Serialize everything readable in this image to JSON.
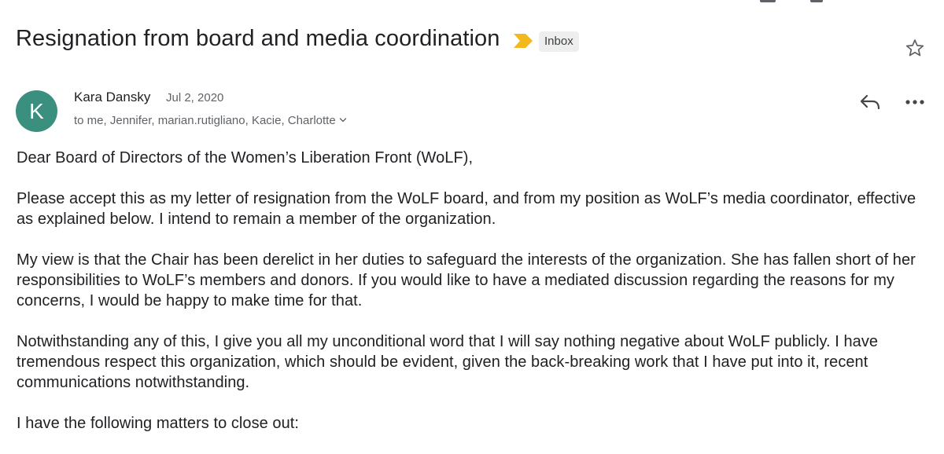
{
  "email": {
    "subject": "Resignation from board and media coordination",
    "label": "Inbox",
    "sender": {
      "initial": "K",
      "name": "Kara Dansky",
      "date": "Jul 2, 2020",
      "recipients": "to me, Jennifer, marian.rutigliano, Kacie, Charlotte"
    },
    "body": [
      "Dear Board of Directors of the Women’s Liberation Front (WoLF),",
      "Please accept this as my letter of resignation from the WoLF board, and from my position as WoLF’s media coordinator, effective as explained below. I intend to remain a member of the organization.",
      "My view is that the Chair has been derelict in her duties to safeguard the interests of the organization. She has fallen short of her responsibilities to WoLF’s members and donors. If you would like to have a mediated discussion regarding the reasons for my concerns, I would be happy to make time for that.",
      "Notwithstanding any of this, I give you all my unconditional word that I will say nothing negative about WoLF publicly. I have tremendous respect this organization, which should be evident, given the back-breaking work that I have put into it, recent communications notwithstanding.",
      "I have the following matters to close out:"
    ]
  },
  "icons": {
    "importance": "importance-marker-icon",
    "star": "star-icon",
    "reply": "reply-icon",
    "more": "more-vert-icon",
    "chevron": "chevron-down-icon"
  },
  "colors": {
    "avatar_bg": "#3b8f7f",
    "importance": "#f2b81c",
    "badge_bg": "#eeeeee",
    "secondary_text": "#5f6368"
  }
}
